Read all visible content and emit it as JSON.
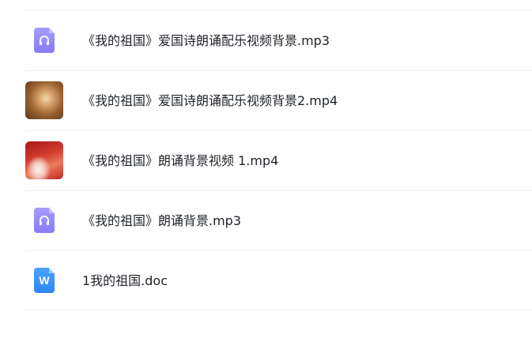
{
  "files": [
    {
      "name": "《我的祖国》爱国诗朗诵配乐视频背景.mp3",
      "type": "audio",
      "icon": "audio-file-icon"
    },
    {
      "name": "《我的祖国》爱国诗朗诵配乐视频背景2.mp4",
      "type": "video",
      "icon": "video-thumbnail"
    },
    {
      "name": "《我的祖国》朗诵背景视频 1.mp4",
      "type": "video",
      "icon": "video-thumbnail"
    },
    {
      "name": "《我的祖国》朗诵背景.mp3",
      "type": "audio",
      "icon": "audio-file-icon"
    },
    {
      "name": "1我的祖国.doc",
      "type": "doc",
      "icon": "word-file-icon",
      "icon_letter": "W"
    }
  ],
  "colors": {
    "audio": "#8b7cf6",
    "doc": "#2f86f6",
    "text": "#1f2329",
    "divider": "#f0f1f3"
  }
}
